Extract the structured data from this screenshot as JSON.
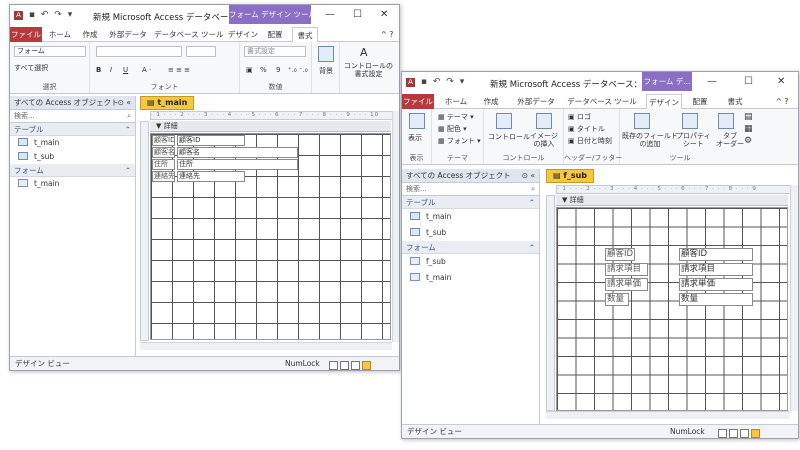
{
  "window1": {
    "title": "新規 Microsoft Access データベース：...",
    "context_tab": "フォーム デザイン ツール",
    "tabs": [
      "ファイル",
      "ホーム",
      "作成",
      "外部データ",
      "データベース ツール",
      "デザイン",
      "配置",
      "書式"
    ],
    "ribbon": {
      "object_combo": "フォーム",
      "select_all": "すべて選択",
      "group_select": "選択",
      "group_font": "フォント",
      "group_number": "数値",
      "format_setting": "書式設定",
      "background_btn": "背景",
      "control_format_btn": "コントロールの\n書式設定",
      "font_buttons": [
        "B",
        "I",
        "U"
      ],
      "number_buttons": [
        "%",
        "9"
      ]
    },
    "nav": {
      "header": "すべての Access オブジェクト",
      "search_placeholder": "検索...",
      "sections": [
        {
          "name": "テーブル",
          "items": [
            "t_main",
            "t_sub"
          ]
        },
        {
          "name": "フォーム",
          "items": [
            "t_main"
          ]
        }
      ]
    },
    "doc_tab": "t_main",
    "detail_label": "詳細",
    "fields": [
      {
        "label": "顧客ID",
        "value": "顧客ID"
      },
      {
        "label": "顧客名",
        "value": "顧客名"
      },
      {
        "label": "住所",
        "value": "住所"
      },
      {
        "label": "連絡先",
        "value": "連絡先"
      }
    ],
    "status": {
      "mode": "デザイン ビュー",
      "numlock": "NumLock"
    }
  },
  "window2": {
    "title": "新規 Microsoft Access データベース：...",
    "context_tab": "フォーム デ...",
    "tabs": [
      "ファイル",
      "ホーム",
      "作成",
      "外部データ",
      "データベース ツール",
      "デザイン",
      "配置",
      "書式"
    ],
    "ribbon": {
      "view_btn": "表示",
      "theme": "テーマ",
      "color": "配色",
      "font": "フォント",
      "control_btn": "コントロール",
      "image_btn": "イメージ\nの挿入",
      "logo": "ロゴ",
      "title_btn": "タイトル",
      "datetime": "日付と時刻",
      "add_fields": "既存のフィールド\nの追加",
      "property_sheet": "プロパティ\nシート",
      "tab_order": "タブ\nオーダー",
      "group_view": "表示",
      "group_theme": "テーマ",
      "group_control": "コントロール",
      "group_header": "ヘッダー/フッター",
      "group_tools": "ツール"
    },
    "nav": {
      "header": "すべての Access オブジェクト",
      "search_placeholder": "検索...",
      "sections": [
        {
          "name": "テーブル",
          "items": [
            "t_main",
            "t_sub"
          ]
        },
        {
          "name": "フォーム",
          "items": [
            "f_sub",
            "t_main"
          ]
        }
      ]
    },
    "doc_tab": "f_sub",
    "detail_label": "詳細",
    "fields": [
      {
        "label": "顧客ID",
        "value": "顧客ID"
      },
      {
        "label": "請求項目",
        "value": "請求項目"
      },
      {
        "label": "請求単価",
        "value": "請求単価"
      },
      {
        "label": "数量",
        "value": "数量"
      }
    ],
    "status": {
      "mode": "デザイン ビュー",
      "numlock": "NumLock"
    }
  }
}
